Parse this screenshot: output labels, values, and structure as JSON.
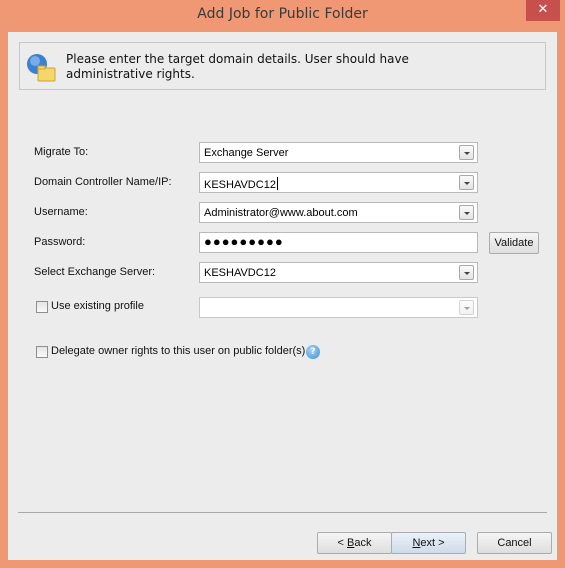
{
  "window": {
    "title": "Add Job for Public Folder",
    "close_glyph": "✕"
  },
  "info": {
    "icon": "globe-folder-icon",
    "message": "Please enter the target domain details. User should have administrative rights."
  },
  "form": {
    "migrate_to": {
      "label": "Migrate To:",
      "value": "Exchange Server"
    },
    "domain_controller": {
      "label": "Domain Controller Name/IP:",
      "value": "KESHAVDC12"
    },
    "username": {
      "label": "Username:",
      "value": "Administrator@www.about.com"
    },
    "password": {
      "label": "Password:",
      "value": "●●●●●●●●●",
      "validate_label": "Validate"
    },
    "exchange_server": {
      "label": "Select Exchange Server:",
      "value": "KESHAVDC12"
    },
    "use_existing_profile": {
      "label": "Use existing profile",
      "checked": false,
      "value": ""
    },
    "delegate_owner_rights": {
      "label": "Delegate owner rights to this user on public folder(s).",
      "checked": false,
      "help_glyph": "?"
    }
  },
  "buttons": {
    "back": {
      "prefix": "< ",
      "accel": "B",
      "rest": "ack"
    },
    "next": {
      "accel": "N",
      "rest": "ext >"
    },
    "cancel": "Cancel"
  }
}
